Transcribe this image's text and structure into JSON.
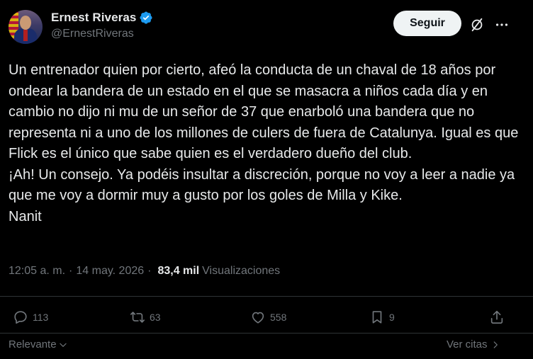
{
  "author": {
    "display_name": "Ernest Riveras",
    "handle": "@ErnestRiveras",
    "verified_icon": "verified-badge-icon"
  },
  "header": {
    "follow_label": "Seguir",
    "grok_icon": "grok-icon",
    "more_icon": "more-options-icon"
  },
  "tweet": {
    "paragraph_1": "Un entrenador quien por cierto, afeó la conducta de un chaval de 18 años por ondear la bandera de un estado en el que se masacra a niños cada día y en cambio no dijo ni mu de un señor de 37 que enarboló una bandera que no representa ni a uno de los millones de culers de fuera de Catalunya. Igual es que Flick es el único que sabe quien es el verdadero dueño del club.",
    "paragraph_2": "¡Ah! Un consejo. Ya podéis insultar a discreción, porque no voy a leer a nadie ya que me voy a dormir muy a gusto por los goles de Milla y Kike.",
    "paragraph_3": "Nanit"
  },
  "meta": {
    "time": "12:05 a. m.",
    "separator": "·",
    "date": "14 may. 2026",
    "views_count": "83,4 mil",
    "views_label": "Visualizaciones"
  },
  "actions": {
    "replies": "113",
    "reposts": "63",
    "likes": "558",
    "bookmarks": "9"
  },
  "footer": {
    "sort_label": "Relevante",
    "quotes_label": "Ver citas"
  },
  "colors": {
    "background": "#000000",
    "text": "#e7e9ea",
    "muted": "#71767b",
    "verified": "#1d9bf0",
    "follow_bg": "#eff3f4"
  }
}
